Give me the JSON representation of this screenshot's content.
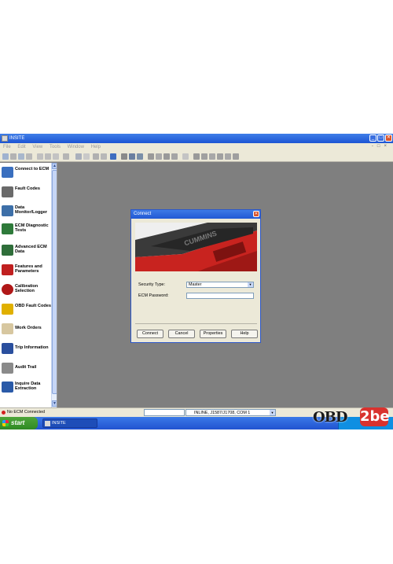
{
  "window": {
    "title": "INSITE"
  },
  "menu": [
    "File",
    "Edit",
    "View",
    "Tools",
    "Window",
    "Help"
  ],
  "sidebar": {
    "items": [
      {
        "label": "Connect to ECM",
        "icon": "connect-icon",
        "color": "#3a6fbf"
      },
      {
        "label": "Fault Codes",
        "icon": "fault-codes-icon",
        "color": "#6a6a6a"
      },
      {
        "label": "Data Monitor/Logger",
        "icon": "data-monitor-icon",
        "color": "#3d6fa8"
      },
      {
        "label": "ECM Diagnostic Tests",
        "icon": "diagnostic-tests-icon",
        "color": "#2e7a3a"
      },
      {
        "label": "Advanced ECM Data",
        "icon": "advanced-data-icon",
        "color": "#2f6e3a"
      },
      {
        "label": "Features and Parameters",
        "icon": "features-icon",
        "color": "#c02020"
      },
      {
        "label": "Calibration Selection",
        "icon": "calibration-icon",
        "color": "#b01818"
      },
      {
        "label": "OBD Fault Codes",
        "icon": "obd-fault-icon",
        "color": "#e0b000"
      },
      {
        "label": "Work Orders",
        "icon": "work-orders-icon",
        "color": "#d7c7a0"
      },
      {
        "label": "Trip Information",
        "icon": "trip-info-icon",
        "color": "#2a4f9e"
      },
      {
        "label": "Audit Trail",
        "icon": "audit-trail-icon",
        "color": "#8a8a8a"
      },
      {
        "label": "Inquire Data Extraction",
        "icon": "inquire-data-icon",
        "color": "#2a5aa8"
      }
    ]
  },
  "status": {
    "connection": "No ECM Connected",
    "adapter": "INLINE, J1587/J1708, COM 1"
  },
  "taskbar": {
    "start": "start",
    "app": "INSITE"
  },
  "dialog": {
    "title": "Connect",
    "security_label": "Security Type:",
    "security_value": "Master",
    "password_label": "ECM Password:",
    "password_value": "",
    "buttons": {
      "connect": "Connect",
      "cancel": "Cancel",
      "properties": "Properties",
      "help": "Help"
    },
    "image_brand": "CUMMINS"
  },
  "watermark": {
    "left": "OBD",
    "right": "2be"
  },
  "colors": {
    "accent": "#2158d4",
    "desktop": "#7f7f7f",
    "status_red": "#d32020"
  }
}
